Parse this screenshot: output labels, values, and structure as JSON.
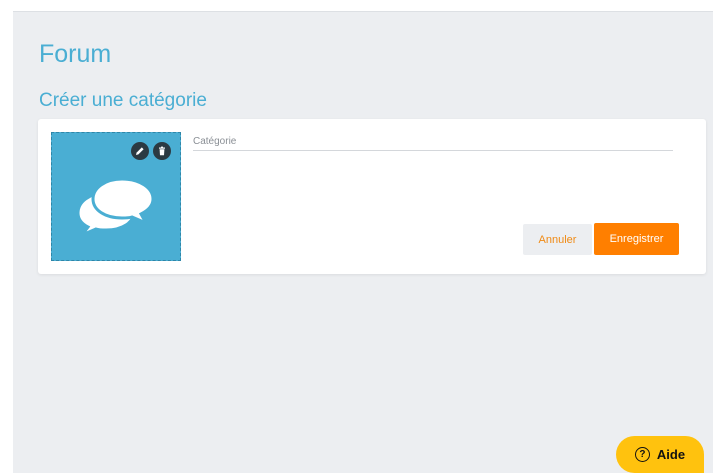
{
  "page": {
    "title": "Forum",
    "section_title": "Créer une catégorie"
  },
  "form": {
    "category_placeholder": "Catégorie",
    "category_value": "",
    "cancel_label": "Annuler",
    "save_label": "Enregistrer"
  },
  "image": {
    "icon": "chat-bubbles-icon",
    "edit_icon": "pencil-icon",
    "delete_icon": "trash-icon"
  },
  "help": {
    "label": "Aide",
    "icon": "question-circle-icon"
  },
  "colors": {
    "accent": "#4aaed3",
    "primary_button": "#ff7f00",
    "help_button": "#ffc20e",
    "background": "#eceef1"
  }
}
